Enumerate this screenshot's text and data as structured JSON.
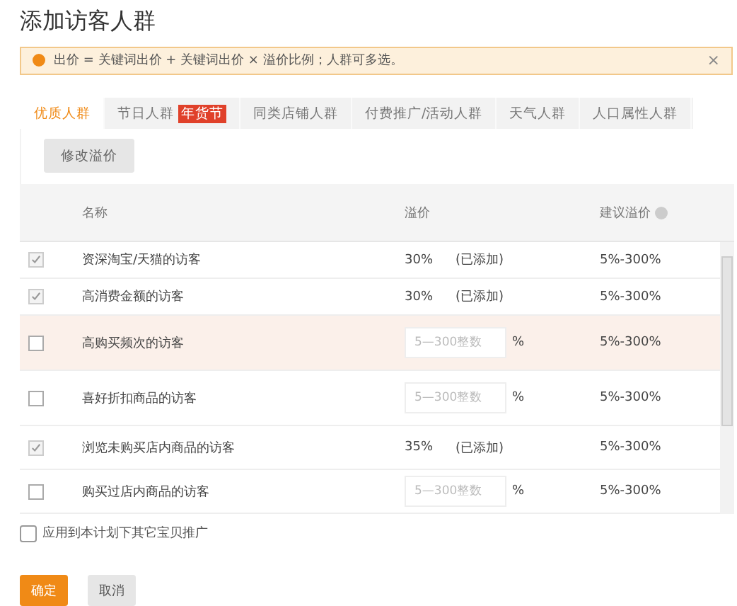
{
  "dialog": {
    "title": "添加访客人群"
  },
  "alert": {
    "text": "出价 = 关键词出价 + 关键词出价 × 溢价比例；人群可多选。",
    "close": "×"
  },
  "tabs": [
    {
      "label": "优质人群",
      "selected": true
    },
    {
      "label": "节日人群",
      "badge": "年货节",
      "selected": false
    },
    {
      "label": "同类店铺人群",
      "selected": false
    },
    {
      "label": "付费推广/活动人群",
      "selected": false
    },
    {
      "label": "天气人群",
      "selected": false
    },
    {
      "label": "人口属性人群",
      "selected": false
    }
  ],
  "modify_button": "修改溢价",
  "table": {
    "columns": [
      "名称",
      "溢价",
      "建议溢价"
    ],
    "rows": [
      {
        "checked": true,
        "highlighted": false,
        "name": "资深淘宝/天猫的访客",
        "kind": "added",
        "premium": "30%",
        "status": "(已添加)",
        "suggested": "5%-300%"
      },
      {
        "checked": true,
        "highlighted": false,
        "name": "高消费金额的访客",
        "kind": "added",
        "premium": "30%",
        "status": "(已添加)",
        "suggested": "5%-300%"
      },
      {
        "checked": false,
        "highlighted": true,
        "name": "高购买频次的访客",
        "kind": "input",
        "placeholder": "5—300整数",
        "unit": "%",
        "suggested": "5%-300%"
      },
      {
        "checked": false,
        "highlighted": false,
        "name": "喜好折扣商品的访客",
        "kind": "input",
        "placeholder": "5—300整数",
        "unit": "%",
        "suggested": "5%-300%"
      },
      {
        "checked": true,
        "highlighted": false,
        "name": "浏览未购买店内商品的访客",
        "kind": "added",
        "premium": "35%",
        "status": "(已添加)",
        "suggested": "5%-300%"
      },
      {
        "checked": false,
        "highlighted": false,
        "name": "购买过店内商品的访客",
        "kind": "input",
        "placeholder": "5—300整数",
        "unit": "%",
        "suggested": "5%-300%"
      }
    ]
  },
  "apply_option": {
    "label": "应用到本计划下其它宝贝推广",
    "checked": false
  },
  "buttons": [
    {
      "label": "确定",
      "kind": "primary"
    },
    {
      "label": "取消",
      "kind": "secondary"
    }
  ]
}
